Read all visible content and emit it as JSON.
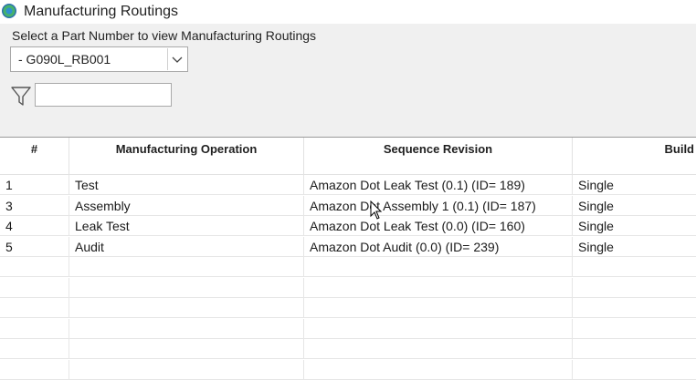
{
  "window": {
    "title": "Manufacturing Routings"
  },
  "selector": {
    "prompt": "Select a Part Number to view Manufacturing Routings",
    "selected_part": "- G090L_RB001",
    "filter_value": ""
  },
  "table": {
    "headers": [
      "#",
      "Manufacturing Operation",
      "Sequence Revision",
      "Build"
    ],
    "rows": [
      {
        "num": "1",
        "operation": "Test",
        "revision": "Amazon Dot Leak Test (0.1) (ID= 189)",
        "build": "Single"
      },
      {
        "num": "3",
        "operation": "Assembly",
        "revision": "Amazon Dot Assembly 1 (0.1) (ID= 187)",
        "build": "Single"
      },
      {
        "num": "4",
        "operation": "Leak Test",
        "revision": "Amazon Dot Leak Test (0.0) (ID= 160)",
        "build": "Single"
      },
      {
        "num": "5",
        "operation": "Audit",
        "revision": "Amazon Dot Audit (0.0) (ID= 239)",
        "build": "Single"
      },
      {
        "num": "",
        "operation": "",
        "revision": "",
        "build": ""
      },
      {
        "num": "",
        "operation": "",
        "revision": "",
        "build": ""
      },
      {
        "num": "",
        "operation": "",
        "revision": "",
        "build": ""
      },
      {
        "num": "",
        "operation": "",
        "revision": "",
        "build": ""
      },
      {
        "num": "",
        "operation": "",
        "revision": "",
        "build": ""
      },
      {
        "num": "",
        "operation": "",
        "revision": "",
        "build": ""
      }
    ]
  }
}
